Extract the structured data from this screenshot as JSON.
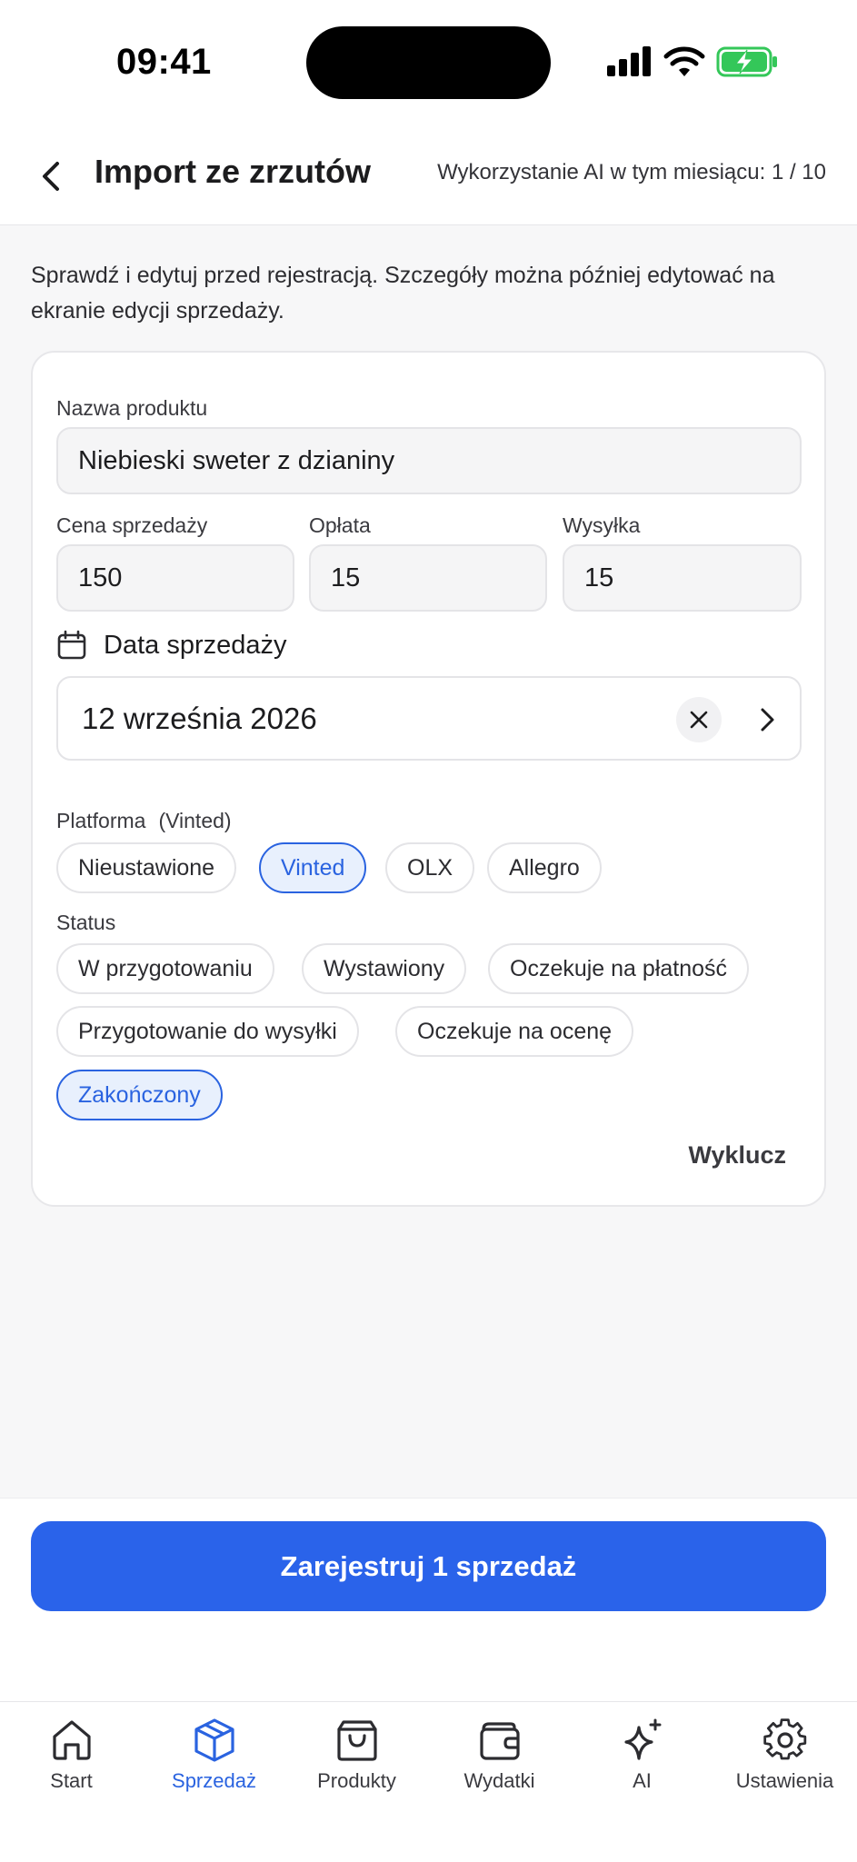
{
  "status_bar": {
    "time": "09:41"
  },
  "header": {
    "title": "Import ze zrzutów",
    "ai_usage": "Wykorzystanie AI w tym miesiącu: 1 / 10"
  },
  "intro": "Sprawdź i edytuj przed rejestracją. Szczegóły można później edytować na ekranie edycji sprzedaży.",
  "form": {
    "product_name_label": "Nazwa produktu",
    "product_name_value": "Niebieski sweter z dzianiny",
    "price_label": "Cena sprzedaży",
    "price_value": "150",
    "fee_label": "Opłata",
    "fee_value": "15",
    "shipping_label": "Wysyłka",
    "shipping_value": "15",
    "date_label": "Data sprzedaży",
    "date_value": "12 września 2026",
    "platform_label": "Platforma",
    "platform_current": "(Vinted)",
    "platforms": [
      "Nieustawione",
      "Vinted",
      "OLX",
      "Allegro"
    ],
    "platform_selected": "Vinted",
    "status_label": "Status",
    "statuses": [
      "W przygotowaniu",
      "Wystawiony",
      "Oczekuje na płatność",
      "Przygotowanie do wysyłki",
      "Oczekuje na ocenę",
      "Zakończony"
    ],
    "status_selected": "Zakończony",
    "exclude_label": "Wyklucz"
  },
  "primary_button": "Zarejestruj 1 sprzedaż",
  "tabbar": {
    "items": [
      {
        "label": "Start",
        "icon": "home-icon"
      },
      {
        "label": "Sprzedaż",
        "icon": "box-icon"
      },
      {
        "label": "Produkty",
        "icon": "bag-icon"
      },
      {
        "label": "Wydatki",
        "icon": "wallet-icon"
      },
      {
        "label": "AI",
        "icon": "sparkle-icon"
      },
      {
        "label": "Ustawienia",
        "icon": "gear-icon"
      }
    ],
    "active": "Sprzedaż"
  },
  "colors": {
    "accent": "#2a63ea",
    "chip_selected_bg": "#e8f0fd",
    "battery_green": "#34c759"
  }
}
